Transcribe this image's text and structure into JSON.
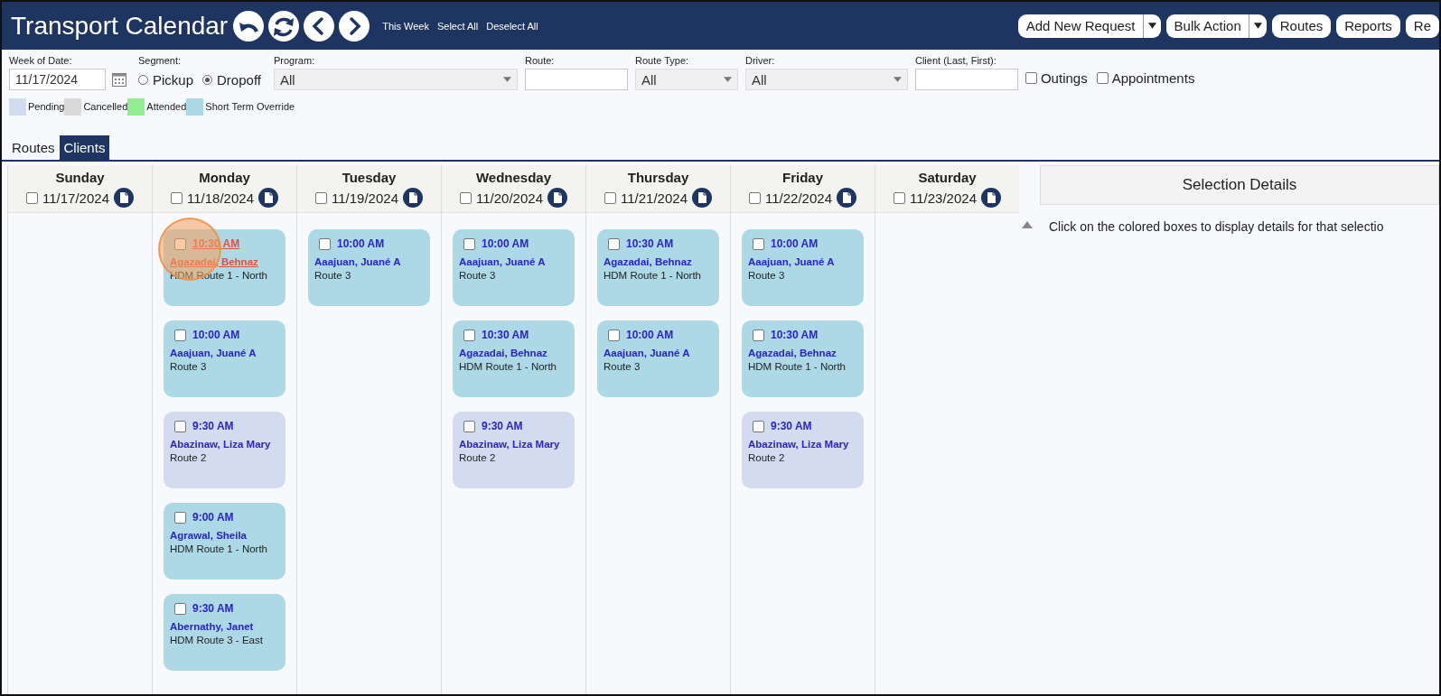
{
  "header": {
    "title": "Transport Calendar",
    "links": [
      "This Week",
      "Select All",
      "Deselect All"
    ],
    "buttons": [
      {
        "label": "Add New Request",
        "dropdown": true
      },
      {
        "label": "Bulk Action",
        "dropdown": true
      },
      {
        "label": "Routes",
        "dropdown": false
      },
      {
        "label": "Reports",
        "dropdown": false
      },
      {
        "label": "Re",
        "dropdown": false
      }
    ]
  },
  "filters": {
    "week_of_date": {
      "label": "Week of Date:",
      "value": "11/17/2024"
    },
    "segment": {
      "label": "Segment:",
      "options": [
        {
          "label": "Pickup",
          "selected": false
        },
        {
          "label": "Dropoff",
          "selected": true
        }
      ]
    },
    "program": {
      "label": "Program:",
      "value": "All"
    },
    "route": {
      "label": "Route:"
    },
    "route_type": {
      "label": "Route Type:",
      "value": "All"
    },
    "driver": {
      "label": "Driver:",
      "value": "All"
    },
    "client": {
      "label": "Client (Last, First):"
    },
    "checkboxes": [
      {
        "label": "Outings",
        "checked": false
      },
      {
        "label": "Appointments",
        "checked": false
      }
    ]
  },
  "legend": [
    {
      "label": "Pending",
      "color": "#d3dcee"
    },
    {
      "label": "Cancelled",
      "color": "#d9d9d9"
    },
    {
      "label": "Attended",
      "color": "#90ee90"
    },
    {
      "label": "Short Term Override",
      "color": "#add8e6"
    }
  ],
  "tabs": [
    {
      "label": "Routes",
      "selected": false
    },
    {
      "label": "Clients",
      "selected": true
    }
  ],
  "days": [
    {
      "name": "Sunday",
      "date": "11/17/2024",
      "checked": false
    },
    {
      "name": "Monday",
      "date": "11/18/2024",
      "checked": false,
      "entries": [
        {
          "time": "10:30 AM",
          "client": "Agazadai, Behnaz",
          "route": "HDM Route 1 - North",
          "kind": "override",
          "checked": false,
          "highlighted": true
        },
        {
          "time": "10:00 AM",
          "client": "Aaajuan, Juané A",
          "route": "Route 3",
          "kind": "override",
          "checked": false,
          "highlighted": false
        },
        {
          "time": "9:30 AM",
          "client": "Abazinaw, Liza Mary",
          "route": "Route 2",
          "kind": "pending",
          "checked": false,
          "highlighted": false
        },
        {
          "time": "9:00 AM",
          "client": "Agrawal, Sheila",
          "route": "HDM Route 1 - North",
          "kind": "override",
          "checked": false,
          "highlighted": false
        },
        {
          "time": "9:30 AM",
          "client": "Abernathy, Janet",
          "route": "HDM Route 3 - East",
          "kind": "override",
          "checked": false,
          "highlighted": false
        }
      ]
    },
    {
      "name": "Tuesday",
      "date": "11/19/2024",
      "checked": false,
      "entries": [
        {
          "time": "10:00 AM",
          "client": "Aaajuan, Juané A",
          "route": "Route 3",
          "kind": "override",
          "checked": false,
          "highlighted": false
        }
      ]
    },
    {
      "name": "Wednesday",
      "date": "11/20/2024",
      "checked": false,
      "entries": [
        {
          "time": "10:00 AM",
          "client": "Aaajuan, Juané A",
          "route": "Route 3",
          "kind": "override",
          "checked": false,
          "highlighted": false
        },
        {
          "time": "10:30 AM",
          "client": "Agazadai, Behnaz",
          "route": "HDM Route 1 - North",
          "kind": "override",
          "checked": false,
          "highlighted": false
        },
        {
          "time": "9:30 AM",
          "client": "Abazinaw, Liza Mary",
          "route": "Route 2",
          "kind": "pending",
          "checked": false,
          "highlighted": false
        }
      ]
    },
    {
      "name": "Thursday",
      "date": "11/21/2024",
      "checked": false,
      "entries": [
        {
          "time": "10:30 AM",
          "client": "Agazadai, Behnaz",
          "route": "HDM Route 1 - North",
          "kind": "override",
          "checked": false,
          "highlighted": false
        },
        {
          "time": "10:00 AM",
          "client": "Aaajuan, Juané A",
          "route": "Route 3",
          "kind": "override",
          "checked": false,
          "highlighted": false
        }
      ]
    },
    {
      "name": "Friday",
      "date": "11/22/2024",
      "checked": false,
      "entries": [
        {
          "time": "10:00 AM",
          "client": "Aaajuan, Juané A",
          "route": "Route 3",
          "kind": "override",
          "checked": false,
          "highlighted": false
        },
        {
          "time": "10:30 AM",
          "client": "Agazadai, Behnaz",
          "route": "HDM Route 1 - North",
          "kind": "override",
          "checked": false,
          "highlighted": false
        },
        {
          "time": "9:30 AM",
          "client": "Abazinaw, Liza Mary",
          "route": "Route 2",
          "kind": "pending",
          "checked": false,
          "highlighted": false
        }
      ]
    },
    {
      "name": "Saturday",
      "date": "11/23/2024",
      "checked": false
    }
  ],
  "details": {
    "title": "Selection Details",
    "message": "Click on the colored boxes to display details for that selectio"
  }
}
